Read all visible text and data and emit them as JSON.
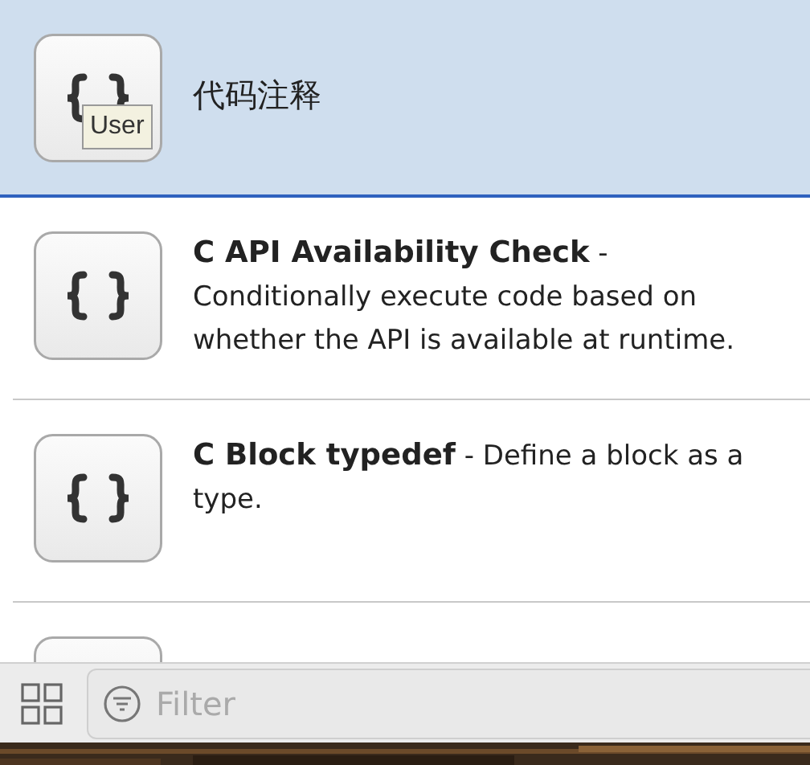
{
  "snippets": [
    {
      "text": "代码注释",
      "selected": true,
      "tooltip": "User"
    },
    {
      "text": "**C API Availability Check** - Conditionally execute code based on whether the API is available at runtime.",
      "selected": false
    },
    {
      "text": "**C Block typedef** - Define a block as a type.",
      "selected": false
    },
    {
      "selected": false
    }
  ],
  "filter": {
    "placeholder": "Filter"
  }
}
